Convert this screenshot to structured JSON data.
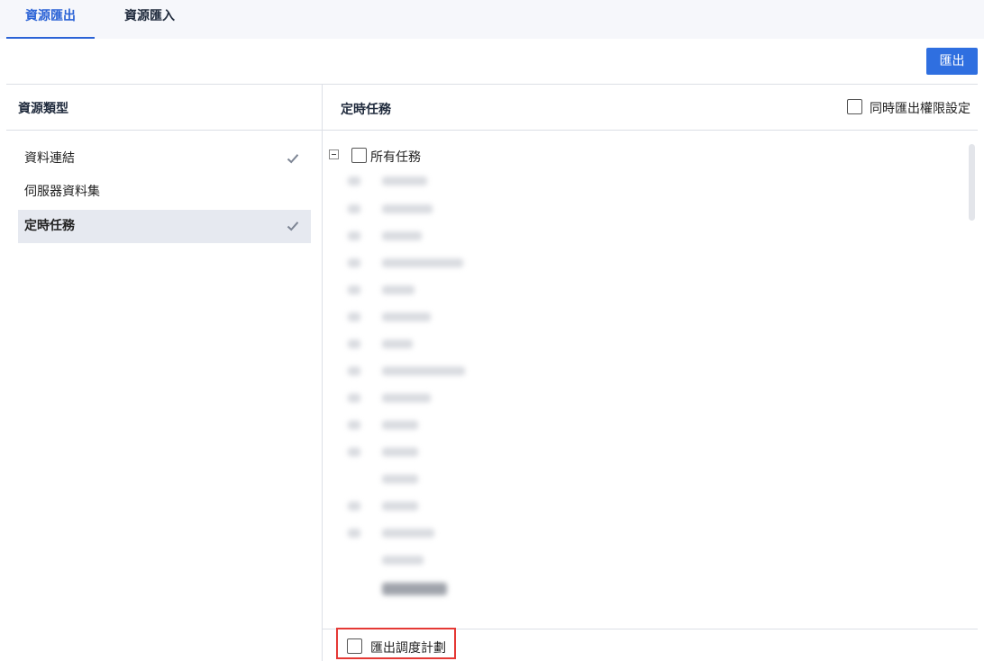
{
  "tabs": [
    {
      "label": "資源匯出",
      "active": true
    },
    {
      "label": "資源匯入",
      "active": false
    }
  ],
  "toolbar": {
    "export_label": "匯出"
  },
  "left_panel": {
    "title": "資源類型",
    "items": [
      {
        "label": "資料連結",
        "checked": true,
        "selected": false
      },
      {
        "label": "伺服器資料集",
        "checked": false,
        "selected": false
      },
      {
        "label": "定時任務",
        "checked": true,
        "selected": true
      }
    ]
  },
  "right_panel": {
    "title": "定時任務",
    "export_permissions_label": "同時匯出權限設定",
    "tree_root_label": "所有任務",
    "export_schedule_label": "匯出調度計劃"
  },
  "colors": {
    "accent": "#2b63d6",
    "button": "#2f6fe0",
    "highlight": "#e53935"
  }
}
